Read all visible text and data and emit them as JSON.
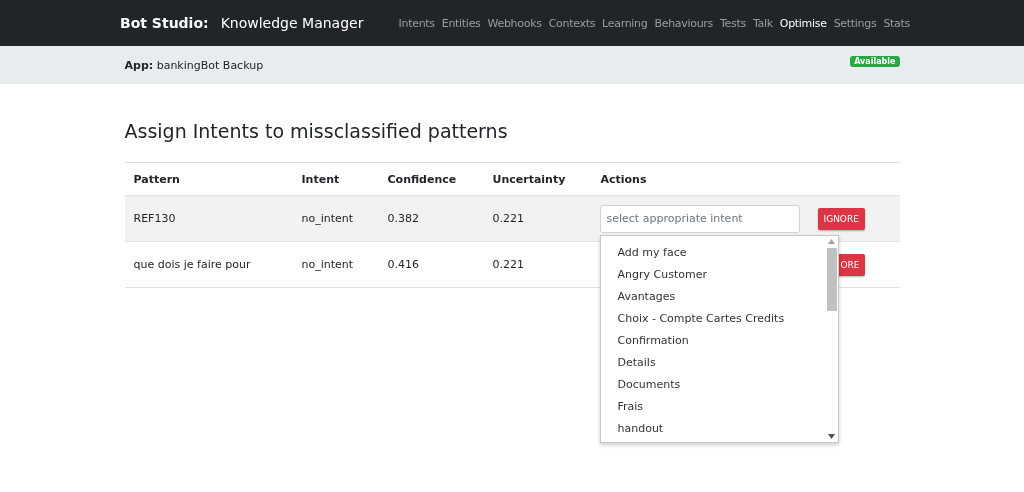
{
  "navbar": {
    "brand": "Bot Studio:",
    "title": "Knowledge Manager",
    "links": [
      {
        "label": "Intents",
        "selected": false
      },
      {
        "label": "Entities",
        "selected": false
      },
      {
        "label": "Webhooks",
        "selected": false
      },
      {
        "label": "Contexts",
        "selected": false
      },
      {
        "label": "Learning",
        "selected": false
      },
      {
        "label": "Behaviours",
        "selected": false
      },
      {
        "label": "Tests",
        "selected": false
      },
      {
        "label": "Talk",
        "selected": false
      },
      {
        "label": "Optimise",
        "selected": true
      },
      {
        "label": "Settings",
        "selected": false
      },
      {
        "label": "Stats",
        "selected": false
      }
    ]
  },
  "app_bar": {
    "label": "App:",
    "name": "bankingBot Backup",
    "status": "Available"
  },
  "heading": "Assign Intents to missclassified patterns",
  "table": {
    "columns": [
      "Pattern",
      "Intent",
      "Confidence",
      "Uncertainty",
      "Actions"
    ],
    "rows": [
      {
        "pattern": "REF130",
        "intent": "no_intent",
        "confidence": "0.382",
        "uncertainty": "0.221",
        "placeholder": "select appropriate intent",
        "button": "IGNORE",
        "dropdown_open": true
      },
      {
        "pattern": "que dois je faire pour",
        "intent": "no_intent",
        "confidence": "0.416",
        "uncertainty": "0.221",
        "button": "ORE",
        "dropdown_open": false
      }
    ]
  },
  "dropdown": {
    "options": [
      "Add my face",
      "Angry Customer",
      "Avantages",
      "Choix - Compte Cartes Credits",
      "Confirmation",
      "Details",
      "Documents",
      "Frais",
      "handout"
    ]
  }
}
